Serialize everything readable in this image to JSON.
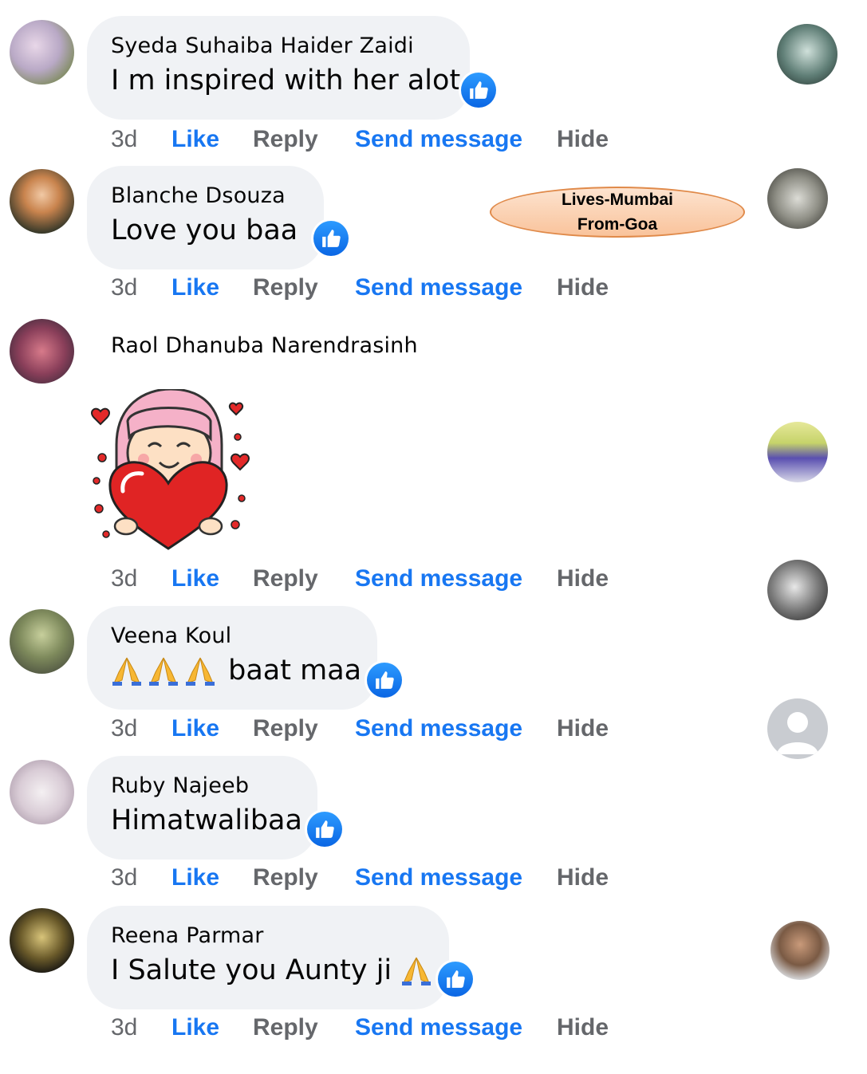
{
  "comments": [
    {
      "author": "Syeda Suhaiba Haider Zaidi",
      "text": "I m inspired with her alot",
      "time": "3d"
    },
    {
      "author": "Blanche Dsouza",
      "text": "Love you baa",
      "time": "3d"
    },
    {
      "author": "Raol Dhanuba Narendrasinh",
      "text": "",
      "time": "3d"
    },
    {
      "author": "Veena Koul",
      "text": "baat maa",
      "time": "3d"
    },
    {
      "author": "Ruby Najeeb",
      "text": "Himatwalibaa",
      "time": "3d"
    },
    {
      "author": "Reena Parmar",
      "text": "I Salute you Aunty ji",
      "time": "3d"
    }
  ],
  "actions": {
    "like": "Like",
    "reply": "Reply",
    "send_message": "Send message",
    "hide": "Hide"
  },
  "annotation": {
    "line1": "Lives-Mumbai",
    "line2": "From-Goa"
  },
  "icons": {
    "reaction": "like-thumb-icon",
    "emoji": "folded-hands-icon",
    "sticker": "girl-holding-heart-sticker"
  },
  "colors": {
    "link": "#1877f2",
    "muted": "#65676b",
    "bubble": "#f0f2f5",
    "callout_fill": "#f9c39b",
    "callout_border": "#e08a4a"
  }
}
